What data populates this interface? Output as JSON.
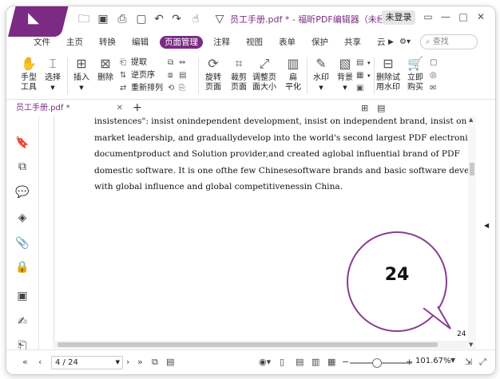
{
  "titlebar": {
    "title": "员工手册.pdf * - 福昕PDF编辑器（未经授权...",
    "login": "未登录"
  },
  "menu": {
    "items": [
      "文件",
      "主页",
      "转换",
      "编辑",
      "页面管理",
      "注释",
      "视图",
      "表单",
      "保护",
      "共享",
      "云"
    ],
    "active": "页面管理",
    "search_placeholder": "查找"
  },
  "toolbar": {
    "hand": "手型\n工具",
    "select": "选择",
    "insert": "插入",
    "delete": "删除",
    "extract": "提取",
    "reverse": "逆页序",
    "reorder": "重新排列",
    "rotate": "旋转\n页面",
    "crop": "裁剪\n页面",
    "resize": "调整页\n面大小",
    "flatten": "扁\n平化",
    "watermark": "水印",
    "background": "背景",
    "remove_trial": "删除试\n用水印",
    "buy": "立即\n购买"
  },
  "tab": {
    "name": "员工手册.pdf *"
  },
  "document": {
    "lines": [
      "insistences\": insist onindependent development,  insist  on  independent brand,  insist  on",
      "market  leadership, and graduallydevelop  into  the  world's  second largest PDF electronic",
      "documentproduct and Solution  provider,and created aglobal  influential brand of PDF",
      "domestic software. It  is  one  ofthe few Chinesesoftware brands and basic software developers",
      "with global  influence and global competitivenessin China."
    ],
    "bubble_number": "24",
    "page_number_small": "24"
  },
  "status": {
    "page_field": "4 / 24",
    "zoom": "101.67%"
  }
}
